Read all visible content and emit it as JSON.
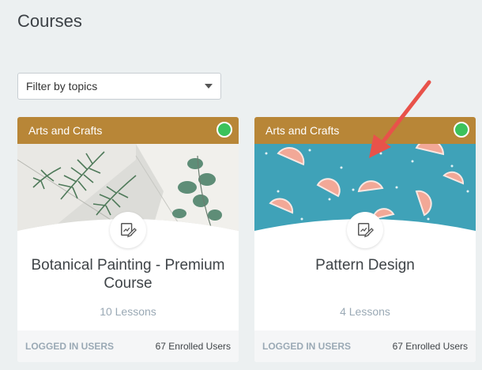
{
  "page": {
    "title": "Courses"
  },
  "filter": {
    "label": "Filter by topics"
  },
  "courses": [
    {
      "category": "Arts and Crafts",
      "title": "Botanical Painting - Premium Course",
      "lessons": "10 Lessons",
      "access": "LOGGED IN USERS",
      "enrolled": "67 Enrolled Users",
      "status_color": "#3cc25b",
      "badge_icon": "edit-certificate-icon",
      "image": "botanical-leaves"
    },
    {
      "category": "Arts and Crafts",
      "title": "Pattern Design",
      "lessons": "4 Lessons",
      "access": "LOGGED IN USERS",
      "enrolled": "67 Enrolled Users",
      "status_color": "#3cc25b",
      "badge_icon": "edit-certificate-icon",
      "image": "grapefruit-pattern"
    }
  ],
  "colors": {
    "header": "#b88637",
    "status": "#3cc25b",
    "annotation_arrow": "#e8524a",
    "background": "#ecf0f1"
  }
}
